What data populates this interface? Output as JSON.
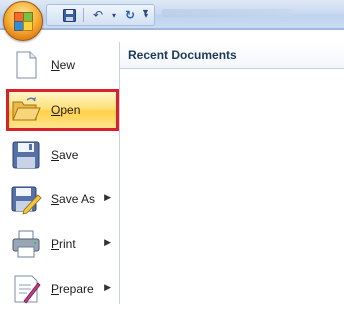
{
  "menu": {
    "recent_header": "Recent Documents",
    "items": [
      {
        "label": "New",
        "icon": "new-document-icon",
        "submenu": false
      },
      {
        "label": "Open",
        "icon": "open-folder-icon",
        "submenu": false,
        "selected": true
      },
      {
        "label": "Save",
        "icon": "save-disk-icon",
        "submenu": false
      },
      {
        "label": "Save As",
        "icon": "save-as-icon",
        "submenu": true
      },
      {
        "label": "Print",
        "icon": "printer-icon",
        "submenu": true
      },
      {
        "label": "Prepare",
        "icon": "prepare-icon",
        "submenu": true
      }
    ]
  },
  "qat": {
    "save_icon": "save-disk-icon",
    "undo_icon": "undo-icon",
    "redo_icon": "redo-icon",
    "customize_icon": "chevron-down-icon"
  },
  "colors": {
    "highlight_border": "#d9212b",
    "selected_fill": "#ffd14a",
    "text_heading": "#1e395b"
  }
}
